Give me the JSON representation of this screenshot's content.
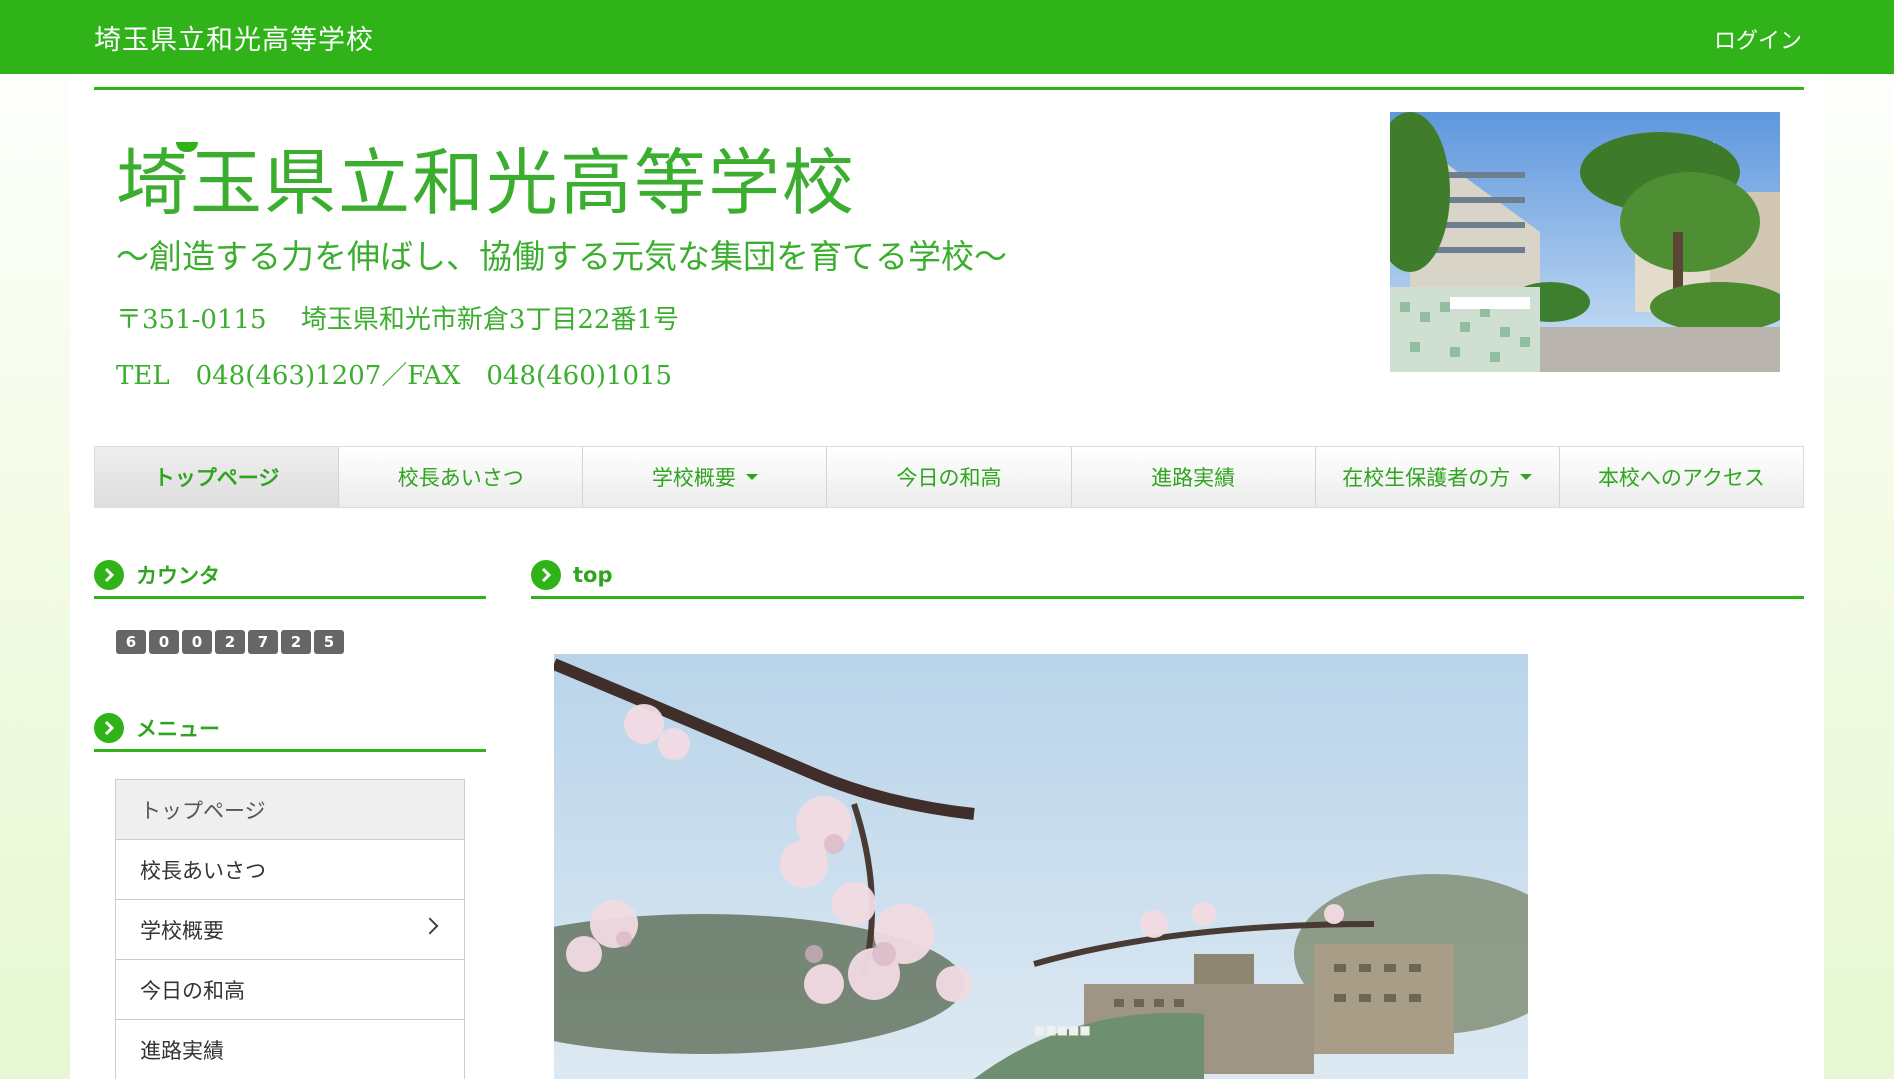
{
  "topbar": {
    "site_name": "埼玉県立和光高等学校",
    "login_label": "ログイン"
  },
  "header": {
    "title": "埼玉県立和光高等学校",
    "motto": "〜創造する力を伸ばし、協働する元気な集団を育てる学校〜",
    "address": "〒351-0115　 埼玉県和光市新倉3丁目22番1号",
    "tel": "TEL　048(463)1207／FAX　048(460)1015"
  },
  "nav": {
    "items": [
      {
        "label": "トップページ"
      },
      {
        "label": "校長あいさつ"
      },
      {
        "label": "学校概要"
      },
      {
        "label": "今日の和高"
      },
      {
        "label": "進路実績"
      },
      {
        "label": "在校生保護者の方"
      },
      {
        "label": "本校へのアクセス"
      }
    ]
  },
  "sidebar": {
    "counter_title": "カウンタ",
    "counter_digits": [
      "6",
      "0",
      "0",
      "2",
      "7",
      "2",
      "5"
    ],
    "menu_title": "メニュー",
    "menu_items": [
      {
        "label": "トップページ"
      },
      {
        "label": "校長あいさつ"
      },
      {
        "label": "学校概要"
      },
      {
        "label": "今日の和高"
      },
      {
        "label": "進路実績"
      }
    ]
  },
  "main": {
    "section_title": "top"
  },
  "colors": {
    "brand_green": "#2fb318",
    "title_green": "#3cae2f"
  }
}
